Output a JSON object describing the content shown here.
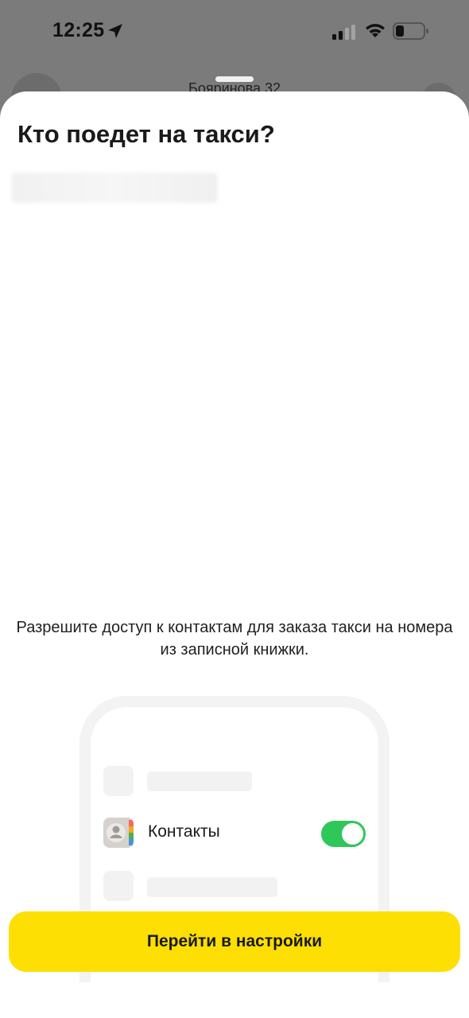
{
  "status_bar": {
    "time": "12:25",
    "icons": [
      "location-arrow-icon",
      "cellular-signal-icon",
      "wifi-icon",
      "battery-icon"
    ]
  },
  "background": {
    "address": "Бояринова 32"
  },
  "sheet": {
    "title": "Кто поедет на такси?",
    "permission_text": "Разрешите доступ к контактам для заказа такси на номера из записной книжки.",
    "illustration": {
      "contacts_label": "Контакты",
      "toggle_on": true,
      "toggle_color": "#2fc75a"
    },
    "settings_button_label": "Перейти в настройки",
    "settings_button_color": "#fddf03"
  }
}
